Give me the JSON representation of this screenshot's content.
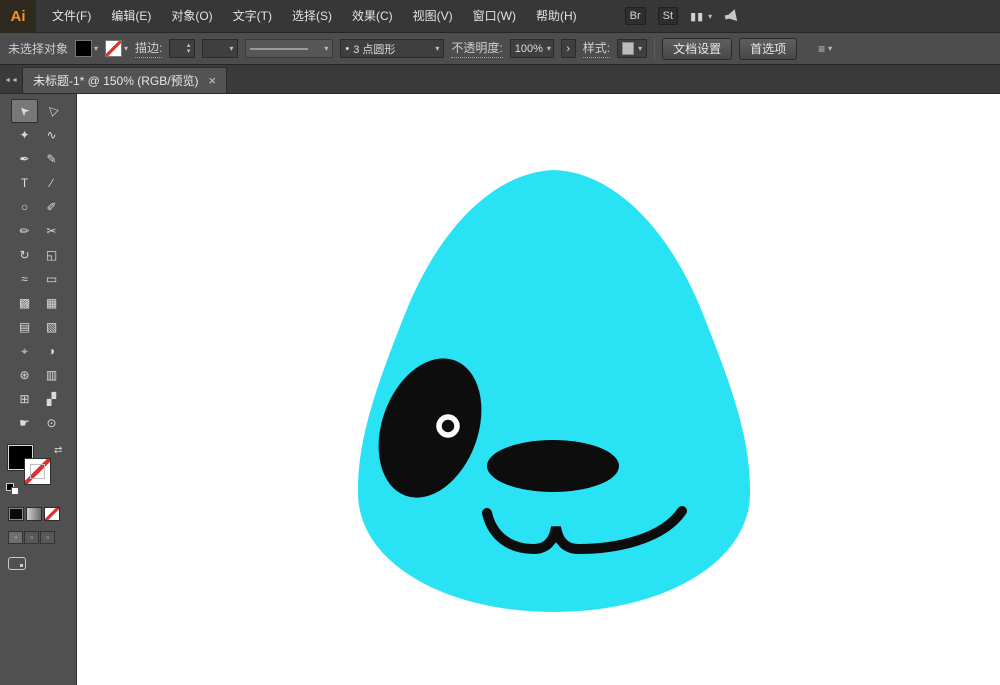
{
  "app": {
    "logo": "Ai"
  },
  "menu_bar": {
    "items": [
      "文件(F)",
      "编辑(E)",
      "对象(O)",
      "文字(T)",
      "选择(S)",
      "效果(C)",
      "视图(V)",
      "窗口(W)",
      "帮助(H)"
    ],
    "bridge_label": "Br",
    "stock_label": "St"
  },
  "control_bar": {
    "status": "未选择对象",
    "fill_color": "#000000",
    "stroke_setting": "none",
    "stroke_label": "描边:",
    "brush_bullet": "•",
    "brush_preset": "3 点圆形",
    "opacity_label": "不透明度:",
    "opacity_value": "100%",
    "style_label": "样式:",
    "document_setup_label": "文档设置",
    "preferences_label": "首选项"
  },
  "tab_bar": {
    "title": "未标题-1* @ 150% (RGB/预览)"
  },
  "toolbar": {
    "selected_tool": "selection-tool",
    "tools": [
      {
        "name": "selection-tool",
        "glyph": "➤"
      },
      {
        "name": "direct-selection-tool",
        "glyph": "▷"
      },
      {
        "name": "magic-wand-tool",
        "glyph": "✦"
      },
      {
        "name": "lasso-tool",
        "glyph": "∿"
      },
      {
        "name": "pen-tool",
        "glyph": "✒"
      },
      {
        "name": "curvature-tool",
        "glyph": "✎"
      },
      {
        "name": "type-tool",
        "glyph": "T"
      },
      {
        "name": "line-segment-tool",
        "glyph": "∕"
      },
      {
        "name": "ellipse-tool",
        "glyph": "○"
      },
      {
        "name": "paintbrush-tool",
        "glyph": "✐"
      },
      {
        "name": "pencil-tool",
        "glyph": "✏"
      },
      {
        "name": "scissors-tool",
        "glyph": "✂"
      },
      {
        "name": "rotate-tool",
        "glyph": "↻"
      },
      {
        "name": "scale-tool",
        "glyph": "◱"
      },
      {
        "name": "width-tool",
        "glyph": "≈"
      },
      {
        "name": "free-transform-tool",
        "glyph": "▭"
      },
      {
        "name": "shape-builder-tool",
        "glyph": "▩"
      },
      {
        "name": "perspective-grid-tool",
        "glyph": "▦"
      },
      {
        "name": "mesh-tool",
        "glyph": "▤"
      },
      {
        "name": "gradient-tool",
        "glyph": "▧"
      },
      {
        "name": "eyedropper-tool",
        "glyph": "⌖"
      },
      {
        "name": "blend-tool",
        "glyph": "◑"
      },
      {
        "name": "symbol-sprayer-tool",
        "glyph": "⊛"
      },
      {
        "name": "column-graph-tool",
        "glyph": "▥"
      },
      {
        "name": "artboard-tool",
        "glyph": "⊞"
      },
      {
        "name": "slice-tool",
        "glyph": "▞"
      },
      {
        "name": "hand-tool",
        "glyph": "☛"
      },
      {
        "name": "zoom-tool",
        "glyph": "⊙"
      }
    ]
  },
  "icons": {
    "chevron_down": "▾",
    "spinner_up": "▴",
    "spinner_down": "▾",
    "expand_arrow": "›",
    "collapse_panel": "◄◄",
    "close": "×",
    "swap_arrows": "⇄",
    "workspace_block": "▮▮",
    "draw_mode_square": "▫",
    "menu_lines": "≡"
  },
  "artwork": {
    "canvas_color": "#ffffff",
    "body_color": "#29e3f4",
    "feature_color": "#0d0d0d",
    "eye_ring_color": "#ffffff"
  }
}
